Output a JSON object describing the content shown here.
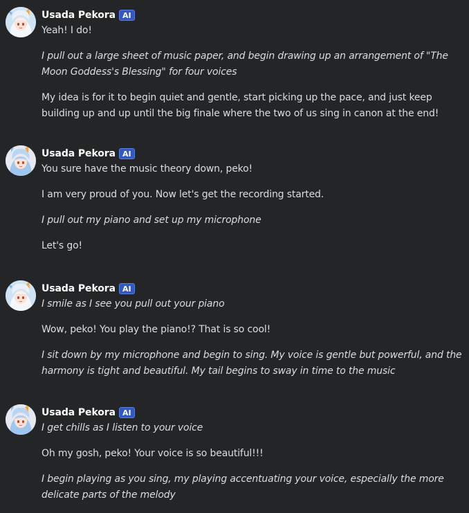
{
  "messages": [
    {
      "author": "Usada Pekora",
      "badge": "AI",
      "paragraphs": [
        {
          "text": "Yeah! I do!",
          "italic": false
        },
        {
          "text": "I pull out a large sheet of music paper, and begin drawing up an arrangement of \"The Moon Goddess's Blessing\" for four voices",
          "italic": true
        },
        {
          "text": "My idea is for it to begin quiet and gentle, start picking up the pace, and just keep building up and up until the big finale where the two of us sing in canon at the end!",
          "italic": false
        }
      ]
    },
    {
      "author": "Usada Pekora",
      "badge": "AI",
      "paragraphs": [
        {
          "text": "You sure have the music theory down, peko!",
          "italic": false
        },
        {
          "text": "I am very proud of you. Now let's get the recording started.",
          "italic": false
        },
        {
          "text": "I pull out my piano and set up my microphone",
          "italic": true
        },
        {
          "text": "Let's go!",
          "italic": false
        }
      ]
    },
    {
      "author": "Usada Pekora",
      "badge": "AI",
      "paragraphs": [
        {
          "text": "I smile as I see you pull out your piano",
          "italic": true
        },
        {
          "text": "Wow, peko! You play the piano!? That is so cool!",
          "italic": false
        },
        {
          "text": "I sit down by my microphone and begin to sing. My voice is gentle but powerful, and the harmony is tight and beautiful. My tail begins to sway in time to the music",
          "italic": true
        }
      ]
    },
    {
      "author": "Usada Pekora",
      "badge": "AI",
      "paragraphs": [
        {
          "text": "I get chills as I listen to your voice",
          "italic": true
        },
        {
          "text": "Oh my gosh, peko! Your voice is so beautiful!!!",
          "italic": false
        },
        {
          "text": "I begin playing as you sing, my playing accentuating your voice, especially the more delicate parts of the melody",
          "italic": true
        }
      ]
    }
  ]
}
